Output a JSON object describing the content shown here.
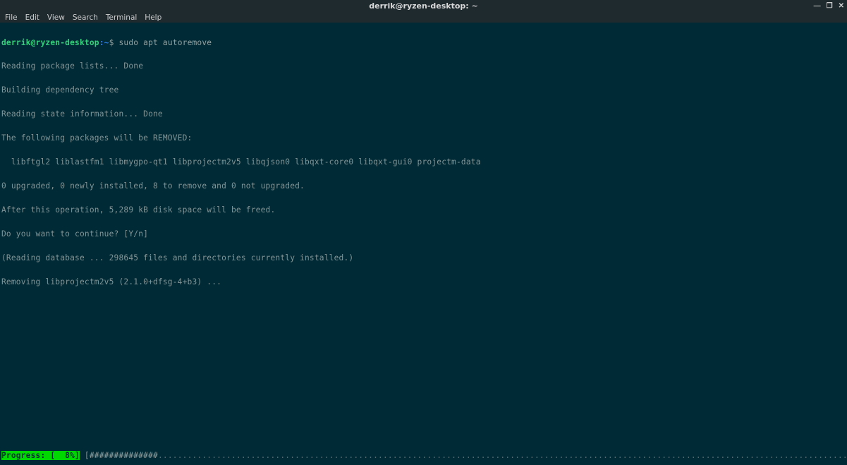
{
  "titlebar": {
    "title": "derrik@ryzen-desktop: ~",
    "controls": {
      "min": "—",
      "max": "❐",
      "close": "✕"
    }
  },
  "menubar": {
    "file": "File",
    "edit": "Edit",
    "view": "View",
    "search": "Search",
    "terminal": "Terminal",
    "help": "Help"
  },
  "prompt": {
    "userhost": "derrik@ryzen-desktop",
    "colon": ":",
    "path": "~",
    "sep": "$ ",
    "command": "sudo apt autoremove"
  },
  "output": {
    "l1": "Reading package lists... Done",
    "l2": "Building dependency tree",
    "l3": "Reading state information... Done",
    "l4": "The following packages will be REMOVED:",
    "l5": "  libftgl2 liblastfm1 libmygpo-qt1 libprojectm2v5 libqjson0 libqxt-core0 libqxt-gui0 projectm-data",
    "l6": "0 upgraded, 0 newly installed, 8 to remove and 0 not upgraded.",
    "l7": "After this operation, 5,289 kB disk space will be freed.",
    "l8": "Do you want to continue? [Y/n]",
    "l9": "(Reading database ... 298645 files and directories currently installed.)",
    "l10": "Removing libprojectm2v5 (2.1.0+dfsg-4+b3) ..."
  },
  "progress": {
    "label": "Progress: [  8%]",
    "open": " [",
    "filled": "##############",
    "dots": "..................................................................................................................................................................................",
    "close": "] "
  }
}
